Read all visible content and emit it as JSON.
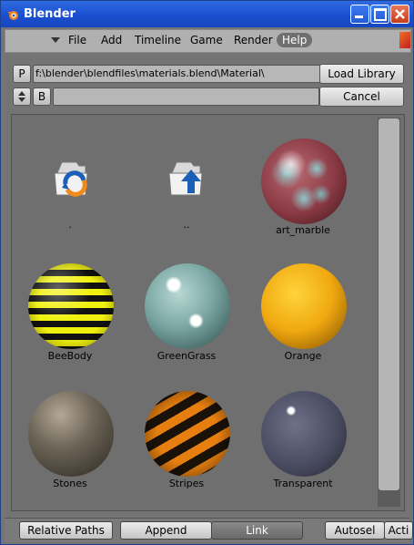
{
  "window": {
    "title": "Blender",
    "buttons": [
      "minimize",
      "maximize",
      "close"
    ]
  },
  "menu": {
    "items": [
      "File",
      "Add",
      "Timeline",
      "Game",
      "Render",
      "Help"
    ],
    "active": "Help"
  },
  "path_row": {
    "p_label": "P",
    "path": "f:\\blender\\blendfiles\\materials.blend\\Material\\",
    "load_button": "Load Library"
  },
  "file_row": {
    "b_label": "B",
    "filename": "",
    "cancel_button": "Cancel"
  },
  "items": [
    {
      "label": ".",
      "kind": "folder-parent-icon"
    },
    {
      "label": "..",
      "kind": "folder-up-icon"
    },
    {
      "label": "art_marble",
      "kind": "material"
    },
    {
      "label": "BeeBody",
      "kind": "material"
    },
    {
      "label": "GreenGrass",
      "kind": "material"
    },
    {
      "label": "Orange",
      "kind": "material"
    },
    {
      "label": "Stones",
      "kind": "material"
    },
    {
      "label": "Stripes",
      "kind": "material"
    },
    {
      "label": "Transparent",
      "kind": "material"
    }
  ],
  "bottom": {
    "relative_paths": "Relative Paths",
    "append": "Append",
    "link": "Link",
    "selected_mode": "Link",
    "autosel": "Autosel",
    "acti": "Acti"
  },
  "colors": {
    "titlebar": "#1b4fd0",
    "panel": "#747474",
    "file_area": "#6f6f6f"
  }
}
